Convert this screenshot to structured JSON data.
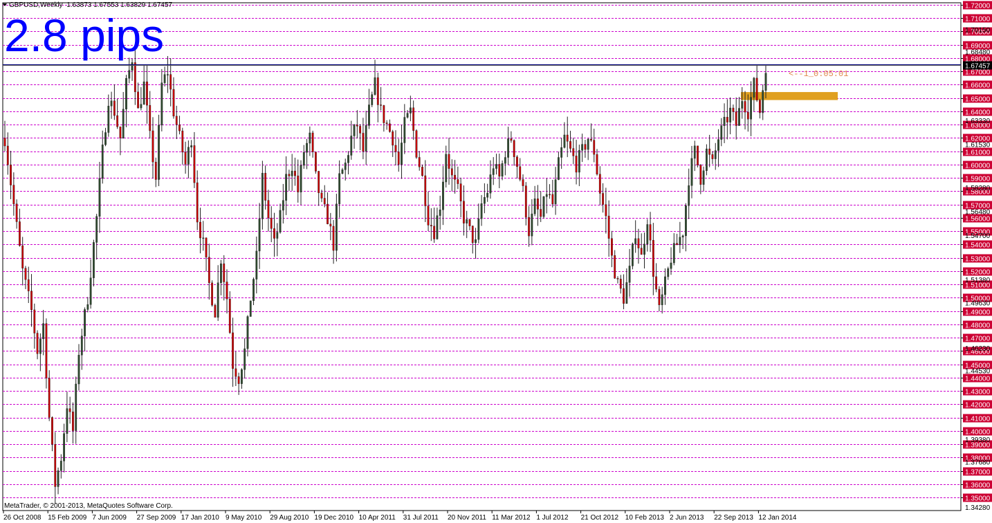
{
  "header": {
    "symbol_text": "GBPUSD,Weekly",
    "ohlc_text": "1.63873 1.67553 1.63829 1.67457"
  },
  "annotation": {
    "big_label": "2.8 pips",
    "countdown_text": "<--1_0:05:01"
  },
  "footer": {
    "copyright": "MetaTrader, © 2001-2013, MetaQuotes Software Corp."
  },
  "colors": {
    "grid_magenta": "#cc00cc",
    "bull_candle": "#2e4a2e",
    "bear_candle": "#cc0000",
    "price_line": "#000080",
    "zone_fill": "#e0a020",
    "axis_label_bg": "#cc0033",
    "big_label": "#0000ff",
    "countdown": "#e0874a"
  },
  "chart_data": {
    "type": "candlestick",
    "symbol": "GBPUSD",
    "timeframe": "Weekly",
    "ylim": [
      1.3428,
      1.72
    ],
    "y_ticks": [
      1.72,
      1.71,
      1.7,
      1.69,
      1.68,
      1.67,
      1.66,
      1.65,
      1.64,
      1.63,
      1.62,
      1.61,
      1.6,
      1.59,
      1.58,
      1.57,
      1.56,
      1.55,
      1.54,
      1.53,
      1.52,
      1.51,
      1.5,
      1.49,
      1.48,
      1.47,
      1.46,
      1.45,
      1.44,
      1.43,
      1.42,
      1.41,
      1.4,
      1.39,
      1.38,
      1.37,
      1.36,
      1.35
    ],
    "y_tick_labels": [
      "1.72000",
      "1.71000",
      "1.70000",
      "1.69000",
      "1.68000",
      "1.67000",
      "1.66000",
      "1.65000",
      "1.64000",
      "1.63000",
      "1.62000",
      "1.61000",
      "1.60000",
      "1.59000",
      "1.58000",
      "1.57000",
      "1.56000",
      "1.55000",
      "1.54000",
      "1.53000",
      "1.52000",
      "1.51000",
      "1.50000",
      "1.49000",
      "1.48000",
      "1.47000",
      "1.46000",
      "1.45000",
      "1.44000",
      "1.43000",
      "1.42000",
      "1.41000",
      "1.40000",
      "1.39000",
      "1.38000",
      "1.37000",
      "1.36000",
      "1.35000"
    ],
    "y_extra_labels": [
      {
        "value": 1.7015,
        "text": "1.70150"
      },
      {
        "value": 1.6848,
        "text": "1.68480"
      },
      {
        "value": 1.6333,
        "text": "1.63330"
      },
      {
        "value": 1.6153,
        "text": "1.61530"
      },
      {
        "value": 1.5828,
        "text": "1.58280"
      },
      {
        "value": 1.5648,
        "text": "1.56480"
      },
      {
        "value": 1.547,
        "text": "1.54700"
      },
      {
        "value": 1.5138,
        "text": "1.51380"
      },
      {
        "value": 1.4963,
        "text": "1.49630"
      },
      {
        "value": 1.4623,
        "text": "1.46230"
      },
      {
        "value": 1.4453,
        "text": "1.44530"
      },
      {
        "value": 1.3938,
        "text": "1.39380"
      },
      {
        "value": 1.3768,
        "text": "1.37680"
      },
      {
        "value": 1.3428,
        "text": "1.34280"
      }
    ],
    "current_price": 1.67457,
    "current_price_label": "1.67457",
    "horizontal_line": 1.6755,
    "zone": {
      "low": 1.6485,
      "high": 1.6545
    },
    "x_labels": [
      "26 Oct 2008",
      "15 Feb 2009",
      "7 Jun 2009",
      "27 Sep 2009",
      "17 Jan 2010",
      "9 May 2010",
      "29 Aug 2010",
      "19 Dec 2010",
      "10 Apr 2011",
      "31 Jul 2011",
      "20 Nov 2011",
      "11 Mar 2012",
      "1 Jul 2012",
      "21 Oct 2012",
      "10 Feb 2013",
      "2 Jun 2013",
      "22 Sep 2013",
      "12 Jan 2014"
    ],
    "price_path": [
      [
        0,
        1.62
      ],
      [
        6,
        1.52
      ],
      [
        9,
        1.49
      ],
      [
        11,
        1.46
      ],
      [
        13,
        1.48
      ],
      [
        15,
        1.41
      ],
      [
        17,
        1.36
      ],
      [
        19,
        1.38
      ],
      [
        21,
        1.42
      ],
      [
        23,
        1.4
      ],
      [
        25,
        1.46
      ],
      [
        28,
        1.5
      ],
      [
        31,
        1.56
      ],
      [
        33,
        1.61
      ],
      [
        35,
        1.65
      ],
      [
        37,
        1.64
      ],
      [
        39,
        1.62
      ],
      [
        41,
        1.66
      ],
      [
        43,
        1.68
      ],
      [
        45,
        1.64
      ],
      [
        47,
        1.66
      ],
      [
        49,
        1.62
      ],
      [
        51,
        1.59
      ],
      [
        53,
        1.66
      ],
      [
        55,
        1.67
      ],
      [
        57,
        1.64
      ],
      [
        59,
        1.62
      ],
      [
        61,
        1.6
      ],
      [
        63,
        1.62
      ],
      [
        65,
        1.56
      ],
      [
        67,
        1.54
      ],
      [
        69,
        1.51
      ],
      [
        71,
        1.49
      ],
      [
        73,
        1.53
      ],
      [
        75,
        1.5
      ],
      [
        77,
        1.45
      ],
      [
        79,
        1.44
      ],
      [
        81,
        1.46
      ],
      [
        83,
        1.5
      ],
      [
        85,
        1.53
      ],
      [
        87,
        1.59
      ],
      [
        89,
        1.56
      ],
      [
        91,
        1.54
      ],
      [
        93,
        1.56
      ],
      [
        95,
        1.59
      ],
      [
        97,
        1.6
      ],
      [
        99,
        1.58
      ],
      [
        101,
        1.61
      ],
      [
        103,
        1.62
      ],
      [
        105,
        1.59
      ],
      [
        107,
        1.57
      ],
      [
        109,
        1.56
      ],
      [
        111,
        1.54
      ],
      [
        113,
        1.59
      ],
      [
        115,
        1.6
      ],
      [
        117,
        1.62
      ],
      [
        119,
        1.63
      ],
      [
        121,
        1.61
      ],
      [
        123,
        1.64
      ],
      [
        125,
        1.66
      ],
      [
        127,
        1.64
      ],
      [
        129,
        1.63
      ],
      [
        131,
        1.62
      ],
      [
        133,
        1.6
      ],
      [
        135,
        1.63
      ],
      [
        137,
        1.64
      ],
      [
        139,
        1.61
      ],
      [
        141,
        1.59
      ],
      [
        143,
        1.56
      ],
      [
        145,
        1.55
      ],
      [
        147,
        1.57
      ],
      [
        149,
        1.61
      ],
      [
        151,
        1.59
      ],
      [
        153,
        1.58
      ],
      [
        155,
        1.56
      ],
      [
        157,
        1.55
      ],
      [
        159,
        1.54
      ],
      [
        161,
        1.57
      ],
      [
        163,
        1.58
      ],
      [
        165,
        1.6
      ],
      [
        167,
        1.59
      ],
      [
        169,
        1.61
      ],
      [
        171,
        1.62
      ],
      [
        173,
        1.6
      ],
      [
        175,
        1.58
      ],
      [
        177,
        1.55
      ],
      [
        179,
        1.57
      ],
      [
        181,
        1.56
      ],
      [
        183,
        1.58
      ],
      [
        185,
        1.57
      ],
      [
        187,
        1.6
      ],
      [
        189,
        1.62
      ],
      [
        191,
        1.61
      ],
      [
        193,
        1.6
      ],
      [
        195,
        1.61
      ],
      [
        197,
        1.62
      ],
      [
        199,
        1.61
      ],
      [
        201,
        1.58
      ],
      [
        203,
        1.56
      ],
      [
        205,
        1.53
      ],
      [
        207,
        1.51
      ],
      [
        209,
        1.5
      ],
      [
        211,
        1.52
      ],
      [
        213,
        1.55
      ],
      [
        215,
        1.53
      ],
      [
        217,
        1.56
      ],
      [
        219,
        1.52
      ],
      [
        221,
        1.49
      ],
      [
        223,
        1.51
      ],
      [
        225,
        1.53
      ],
      [
        227,
        1.54
      ],
      [
        229,
        1.55
      ],
      [
        231,
        1.59
      ],
      [
        233,
        1.61
      ],
      [
        235,
        1.59
      ],
      [
        237,
        1.61
      ],
      [
        239,
        1.6
      ],
      [
        241,
        1.62
      ],
      [
        243,
        1.63
      ],
      [
        245,
        1.64
      ],
      [
        247,
        1.63
      ],
      [
        249,
        1.65
      ],
      [
        251,
        1.64
      ],
      [
        253,
        1.66
      ],
      [
        255,
        1.64
      ],
      [
        257,
        1.67457
      ]
    ]
  }
}
